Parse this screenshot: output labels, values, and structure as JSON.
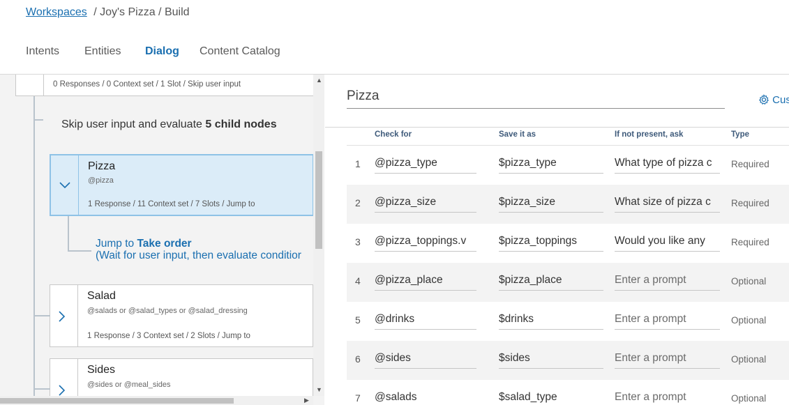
{
  "breadcrumb": {
    "workspaces": "Workspaces",
    "rest": "/ Joy's Pizza / Build"
  },
  "tabs": [
    {
      "label": "Intents"
    },
    {
      "label": "Entities"
    },
    {
      "label": "Dialog"
    },
    {
      "label": "Content Catalog"
    }
  ],
  "tree": {
    "parent_meta": "0 Responses / 0 Context set / 1 Slot / Skip user input",
    "skip_text": "Skip user input and evaluate ",
    "skip_bold": "5 child nodes",
    "nodes": [
      {
        "title": "Pizza",
        "condition": "@pizza",
        "meta": "1 Response / 11 Context set / 7 Slots / Jump to"
      },
      {
        "title": "Salad",
        "condition": "@salads or @salad_types or @salad_dressing",
        "meta": "1 Response / 3 Context set / 2 Slots / Jump to"
      },
      {
        "title": "Sides",
        "condition": "@sides or @meal_sides",
        "meta": ""
      }
    ],
    "jump_prefix": "Jump to ",
    "jump_target": "Take order",
    "jump_sub": "(Wait for user input, then evaluate conditior"
  },
  "editor": {
    "node_name": "Pizza",
    "customize": "Cus",
    "headers": {
      "check": "Check for",
      "save": "Save it as",
      "ask": "If not present, ask",
      "type": "Type"
    },
    "slots": [
      {
        "num": "1",
        "check": "@pizza_type",
        "save": "$pizza_type",
        "ask": "What type of pizza c",
        "type": "Required"
      },
      {
        "num": "2",
        "check": "@pizza_size",
        "save": "$pizza_size",
        "ask": "What size of pizza c",
        "type": "Required"
      },
      {
        "num": "3",
        "check": "@pizza_toppings.v",
        "save": "$pizza_toppings",
        "ask": "Would you like any",
        "type": "Required"
      },
      {
        "num": "4",
        "check": "@pizza_place",
        "save": "$pizza_place",
        "ask": "Enter a prompt",
        "type": "Optional"
      },
      {
        "num": "5",
        "check": "@drinks",
        "save": "$drinks",
        "ask": "Enter a prompt",
        "type": "Optional"
      },
      {
        "num": "6",
        "check": "@sides",
        "save": "$sides",
        "ask": "Enter a prompt",
        "type": "Optional"
      },
      {
        "num": "7",
        "check": "@salads",
        "save": "$salad_type",
        "ask": "Enter a prompt",
        "type": "Optional"
      }
    ]
  }
}
